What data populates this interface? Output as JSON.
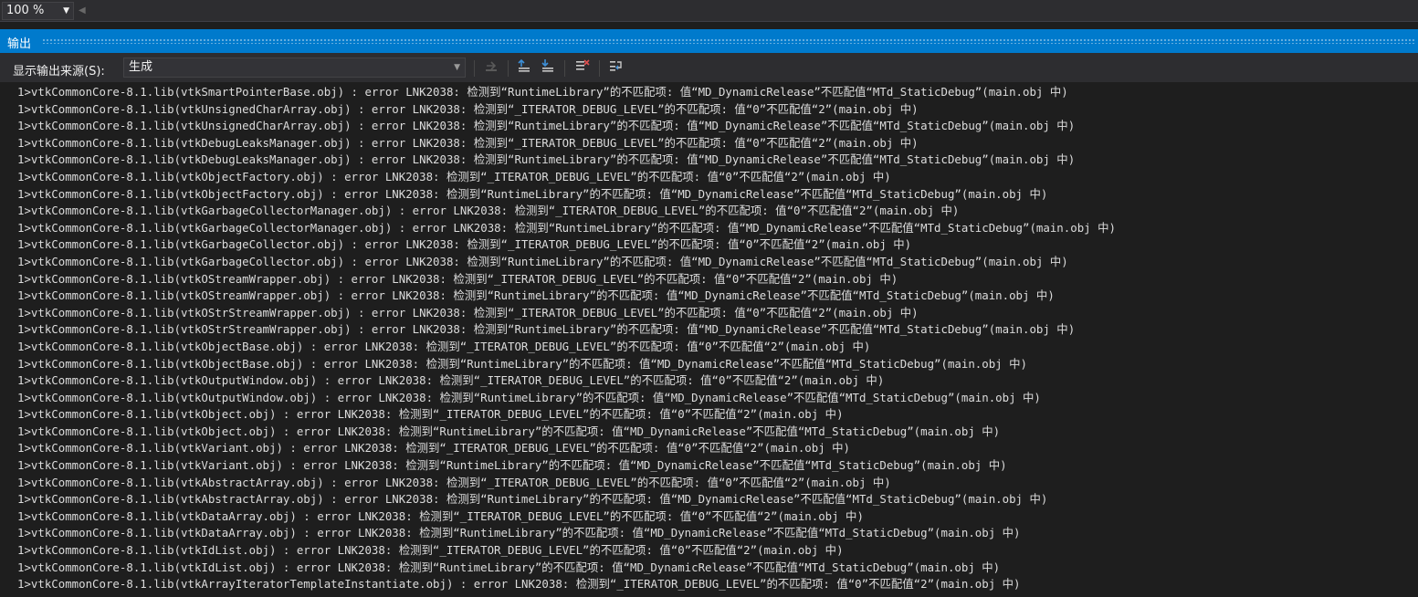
{
  "zoom": {
    "value": "100 %"
  },
  "panel": {
    "title": "输出"
  },
  "toolbar": {
    "source_label": "显示输出来源(S):",
    "source_value": "生成"
  },
  "icons": {
    "dropdown": "chevron-down-icon",
    "goto_message": "goto-message-icon",
    "prev_message": "previous-message-icon",
    "next_message": "next-message-icon",
    "clear_all": "clear-all-icon",
    "word_wrap": "word-wrap-icon"
  },
  "colors": {
    "title_bar": "#007acc",
    "background": "#1e1e1e",
    "toolbar": "#2d2d30",
    "text": "#dcdcdc"
  },
  "output_lines": [
    "1>vtkCommonCore-8.1.lib(vtkSmartPointerBase.obj) : error LNK2038: 检测到“RuntimeLibrary”的不匹配项: 值“MD_DynamicRelease”不匹配值“MTd_StaticDebug”(main.obj 中)",
    "1>vtkCommonCore-8.1.lib(vtkUnsignedCharArray.obj) : error LNK2038: 检测到“_ITERATOR_DEBUG_LEVEL”的不匹配项: 值“0”不匹配值“2”(main.obj 中)",
    "1>vtkCommonCore-8.1.lib(vtkUnsignedCharArray.obj) : error LNK2038: 检测到“RuntimeLibrary”的不匹配项: 值“MD_DynamicRelease”不匹配值“MTd_StaticDebug”(main.obj 中)",
    "1>vtkCommonCore-8.1.lib(vtkDebugLeaksManager.obj) : error LNK2038: 检测到“_ITERATOR_DEBUG_LEVEL”的不匹配项: 值“0”不匹配值“2”(main.obj 中)",
    "1>vtkCommonCore-8.1.lib(vtkDebugLeaksManager.obj) : error LNK2038: 检测到“RuntimeLibrary”的不匹配项: 值“MD_DynamicRelease”不匹配值“MTd_StaticDebug”(main.obj 中)",
    "1>vtkCommonCore-8.1.lib(vtkObjectFactory.obj) : error LNK2038: 检测到“_ITERATOR_DEBUG_LEVEL”的不匹配项: 值“0”不匹配值“2”(main.obj 中)",
    "1>vtkCommonCore-8.1.lib(vtkObjectFactory.obj) : error LNK2038: 检测到“RuntimeLibrary”的不匹配项: 值“MD_DynamicRelease”不匹配值“MTd_StaticDebug”(main.obj 中)",
    "1>vtkCommonCore-8.1.lib(vtkGarbageCollectorManager.obj) : error LNK2038: 检测到“_ITERATOR_DEBUG_LEVEL”的不匹配项: 值“0”不匹配值“2”(main.obj 中)",
    "1>vtkCommonCore-8.1.lib(vtkGarbageCollectorManager.obj) : error LNK2038: 检测到“RuntimeLibrary”的不匹配项: 值“MD_DynamicRelease”不匹配值“MTd_StaticDebug”(main.obj 中)",
    "1>vtkCommonCore-8.1.lib(vtkGarbageCollector.obj) : error LNK2038: 检测到“_ITERATOR_DEBUG_LEVEL”的不匹配项: 值“0”不匹配值“2”(main.obj 中)",
    "1>vtkCommonCore-8.1.lib(vtkGarbageCollector.obj) : error LNK2038: 检测到“RuntimeLibrary”的不匹配项: 值“MD_DynamicRelease”不匹配值“MTd_StaticDebug”(main.obj 中)",
    "1>vtkCommonCore-8.1.lib(vtkOStreamWrapper.obj) : error LNK2038: 检测到“_ITERATOR_DEBUG_LEVEL”的不匹配项: 值“0”不匹配值“2”(main.obj 中)",
    "1>vtkCommonCore-8.1.lib(vtkOStreamWrapper.obj) : error LNK2038: 检测到“RuntimeLibrary”的不匹配项: 值“MD_DynamicRelease”不匹配值“MTd_StaticDebug”(main.obj 中)",
    "1>vtkCommonCore-8.1.lib(vtkOStrStreamWrapper.obj) : error LNK2038: 检测到“_ITERATOR_DEBUG_LEVEL”的不匹配项: 值“0”不匹配值“2”(main.obj 中)",
    "1>vtkCommonCore-8.1.lib(vtkOStrStreamWrapper.obj) : error LNK2038: 检测到“RuntimeLibrary”的不匹配项: 值“MD_DynamicRelease”不匹配值“MTd_StaticDebug”(main.obj 中)",
    "1>vtkCommonCore-8.1.lib(vtkObjectBase.obj) : error LNK2038: 检测到“_ITERATOR_DEBUG_LEVEL”的不匹配项: 值“0”不匹配值“2”(main.obj 中)",
    "1>vtkCommonCore-8.1.lib(vtkObjectBase.obj) : error LNK2038: 检测到“RuntimeLibrary”的不匹配项: 值“MD_DynamicRelease”不匹配值“MTd_StaticDebug”(main.obj 中)",
    "1>vtkCommonCore-8.1.lib(vtkOutputWindow.obj) : error LNK2038: 检测到“_ITERATOR_DEBUG_LEVEL”的不匹配项: 值“0”不匹配值“2”(main.obj 中)",
    "1>vtkCommonCore-8.1.lib(vtkOutputWindow.obj) : error LNK2038: 检测到“RuntimeLibrary”的不匹配项: 值“MD_DynamicRelease”不匹配值“MTd_StaticDebug”(main.obj 中)",
    "1>vtkCommonCore-8.1.lib(vtkObject.obj) : error LNK2038: 检测到“_ITERATOR_DEBUG_LEVEL”的不匹配项: 值“0”不匹配值“2”(main.obj 中)",
    "1>vtkCommonCore-8.1.lib(vtkObject.obj) : error LNK2038: 检测到“RuntimeLibrary”的不匹配项: 值“MD_DynamicRelease”不匹配值“MTd_StaticDebug”(main.obj 中)",
    "1>vtkCommonCore-8.1.lib(vtkVariant.obj) : error LNK2038: 检测到“_ITERATOR_DEBUG_LEVEL”的不匹配项: 值“0”不匹配值“2”(main.obj 中)",
    "1>vtkCommonCore-8.1.lib(vtkVariant.obj) : error LNK2038: 检测到“RuntimeLibrary”的不匹配项: 值“MD_DynamicRelease”不匹配值“MTd_StaticDebug”(main.obj 中)",
    "1>vtkCommonCore-8.1.lib(vtkAbstractArray.obj) : error LNK2038: 检测到“_ITERATOR_DEBUG_LEVEL”的不匹配项: 值“0”不匹配值“2”(main.obj 中)",
    "1>vtkCommonCore-8.1.lib(vtkAbstractArray.obj) : error LNK2038: 检测到“RuntimeLibrary”的不匹配项: 值“MD_DynamicRelease”不匹配值“MTd_StaticDebug”(main.obj 中)",
    "1>vtkCommonCore-8.1.lib(vtkDataArray.obj) : error LNK2038: 检测到“_ITERATOR_DEBUG_LEVEL”的不匹配项: 值“0”不匹配值“2”(main.obj 中)",
    "1>vtkCommonCore-8.1.lib(vtkDataArray.obj) : error LNK2038: 检测到“RuntimeLibrary”的不匹配项: 值“MD_DynamicRelease”不匹配值“MTd_StaticDebug”(main.obj 中)",
    "1>vtkCommonCore-8.1.lib(vtkIdList.obj) : error LNK2038: 检测到“_ITERATOR_DEBUG_LEVEL”的不匹配项: 值“0”不匹配值“2”(main.obj 中)",
    "1>vtkCommonCore-8.1.lib(vtkIdList.obj) : error LNK2038: 检测到“RuntimeLibrary”的不匹配项: 值“MD_DynamicRelease”不匹配值“MTd_StaticDebug”(main.obj 中)",
    "1>vtkCommonCore-8.1.lib(vtkArrayIteratorTemplateInstantiate.obj) : error LNK2038: 检测到“_ITERATOR_DEBUG_LEVEL”的不匹配项: 值“0”不匹配值“2”(main.obj 中)"
  ]
}
